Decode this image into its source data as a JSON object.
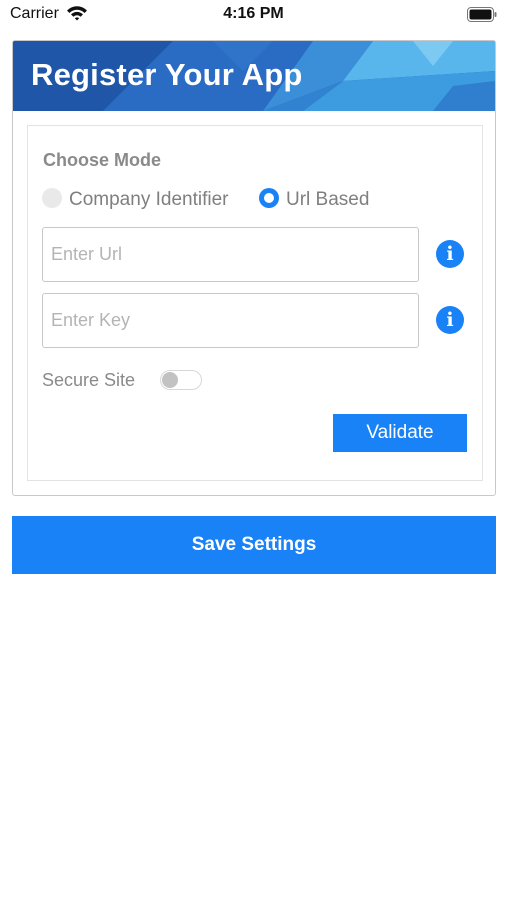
{
  "status_bar": {
    "carrier": "Carrier",
    "time": "4:16 PM",
    "icons": [
      "wifi-icon",
      "battery-icon"
    ]
  },
  "banner": {
    "title": "Register Your App"
  },
  "form": {
    "mode_label": "Choose Mode",
    "modes": [
      {
        "label": "Company Identifier",
        "selected": false
      },
      {
        "label": "Url Based",
        "selected": true
      }
    ],
    "url_field": {
      "placeholder": "Enter Url",
      "value": ""
    },
    "key_field": {
      "placeholder": "Enter Key",
      "value": ""
    },
    "secure_label": "Secure Site",
    "secure_enabled": false,
    "validate_label": "Validate"
  },
  "save_label": "Save Settings",
  "colors": {
    "accent": "#1a82f7",
    "banner_dark": "#1f58b0",
    "banner_light": "#4fb4ea",
    "muted_text": "#8a8a8a"
  }
}
